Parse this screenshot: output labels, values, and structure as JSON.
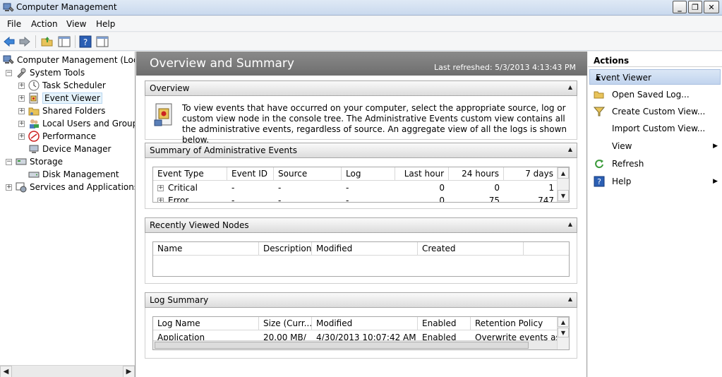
{
  "window": {
    "title": "Computer Management"
  },
  "menu": [
    "File",
    "Action",
    "View",
    "Help"
  ],
  "tree": {
    "root": "Computer Management (Local",
    "system_tools": "System Tools",
    "task_scheduler": "Task Scheduler",
    "event_viewer": "Event Viewer",
    "shared_folders": "Shared Folders",
    "local_users": "Local Users and Groups",
    "performance": "Performance",
    "device_manager": "Device Manager",
    "storage": "Storage",
    "disk_management": "Disk Management",
    "services": "Services and Applications"
  },
  "center": {
    "title": "Overview and Summary",
    "last_refreshed": "Last refreshed: 5/3/2013 4:13:43 PM",
    "overview": {
      "title": "Overview",
      "text": "To view events that have occurred on your computer, select the appropriate source, log or custom view node in the console tree. The Administrative Events custom view contains all the administrative events, regardless of source. An aggregate view of all the logs is shown below."
    },
    "summary": {
      "title": "Summary of Administrative Events",
      "columns": [
        "Event Type",
        "Event ID",
        "Source",
        "Log",
        "Last hour",
        "24 hours",
        "7 days"
      ],
      "rows": [
        [
          "Critical",
          "-",
          "-",
          "-",
          "0",
          "0",
          "1"
        ],
        [
          "Error",
          "-",
          "-",
          "-",
          "0",
          "75",
          "747"
        ]
      ]
    },
    "recent": {
      "title": "Recently Viewed Nodes",
      "columns": [
        "Name",
        "Description",
        "Modified",
        "Created"
      ]
    },
    "log_summary": {
      "title": "Log Summary",
      "columns": [
        "Log Name",
        "Size (Curr...",
        "Modified",
        "Enabled",
        "Retention Policy"
      ],
      "rows": [
        [
          "Application",
          "20.00 MB/",
          "4/30/2013 10:07:42 AM",
          "Enabled",
          "Overwrite events as ne"
        ]
      ]
    }
  },
  "actions": {
    "title": "Actions",
    "group": "Event Viewer",
    "items": [
      "Open Saved Log...",
      "Create Custom View...",
      "Import Custom View...",
      "View",
      "Refresh",
      "Help"
    ]
  }
}
